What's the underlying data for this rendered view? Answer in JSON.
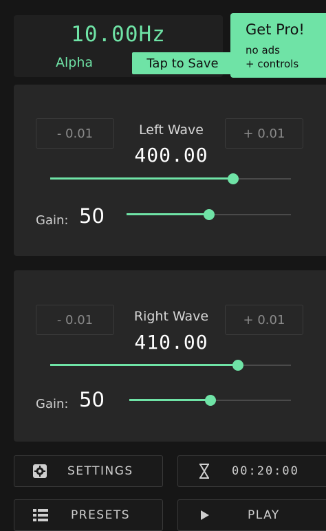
{
  "header": {
    "frequency": "10.00Hz",
    "band": "Alpha",
    "save_label": "Tap to Save",
    "pro": {
      "title": "Get Pro!",
      "line1": "no ads",
      "line2": "+ controls"
    }
  },
  "left_wave": {
    "title": "Left Wave",
    "value": "400.00",
    "minus_label": "- 0.01",
    "plus_label": "+ 0.01",
    "slider_fraction": 0.76,
    "gain_label": "Gain:",
    "gain_value": "50",
    "gain_fraction": 0.5
  },
  "right_wave": {
    "title": "Right Wave",
    "value": "410.00",
    "minus_label": "- 0.01",
    "plus_label": "+ 0.01",
    "slider_fraction": 0.78,
    "gain_label": "Gain:",
    "gain_value": "50",
    "gain_fraction": 0.5
  },
  "controls": {
    "settings_label": "SETTINGS",
    "settings_icon": "gear-icon",
    "timer_value": "00:20:00",
    "timer_icon": "hourglass-icon",
    "presets_label": "PRESETS",
    "presets_icon": "list-icon",
    "play_label": "PLAY",
    "play_icon": "play-icon"
  },
  "colors": {
    "accent": "#6fe3a6",
    "background": "#161616",
    "panel": "#272727"
  }
}
